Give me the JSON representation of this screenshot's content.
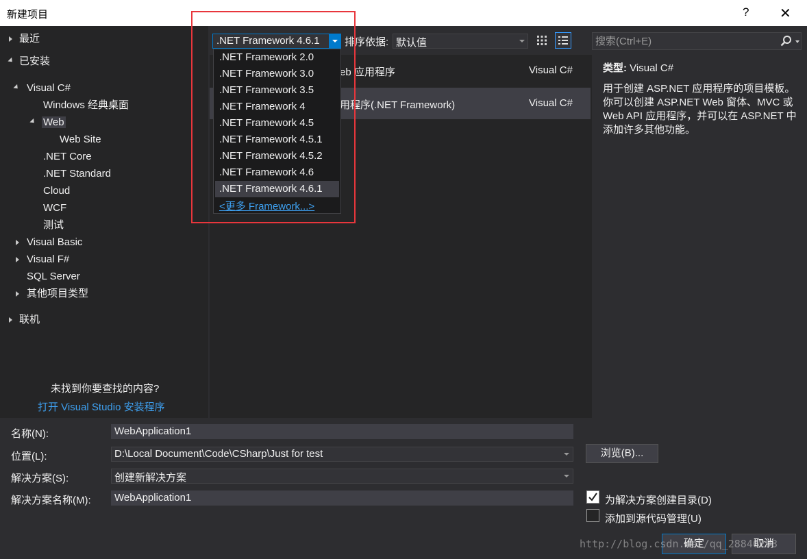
{
  "window": {
    "title": "新建项目",
    "help": "?",
    "close": "✕"
  },
  "tree": {
    "recent": "最近",
    "installed": "已安装",
    "visual_csharp": "Visual C#",
    "windows_desktop": "Windows 经典桌面",
    "web": "Web",
    "web_site": "Web Site",
    "net_core": ".NET Core",
    "net_standard": ".NET Standard",
    "cloud": "Cloud",
    "wcf": "WCF",
    "test": "测试",
    "visual_basic": "Visual Basic",
    "visual_fsharp": "Visual F#",
    "sql_server": "SQL Server",
    "other_types": "其他项目类型",
    "online": "联机",
    "not_found": "未找到你要查找的内容?",
    "open_installer": "打开 Visual Studio 安装程序"
  },
  "toolbar": {
    "framework_selected": ".NET Framework 4.6.1",
    "sort_label": "排序依据:",
    "sort_value": "默认值",
    "search_placeholder": "搜索(Ctrl+E)"
  },
  "framework_options": [
    ".NET Framework 2.0",
    ".NET Framework 3.0",
    ".NET Framework 3.5",
    ".NET Framework 4",
    ".NET Framework 4.5",
    ".NET Framework 4.5.1",
    ".NET Framework 4.5.2",
    ".NET Framework 4.6",
    ".NET Framework 4.6.1"
  ],
  "framework_more": "<更多 Framework...>",
  "templates": [
    {
      "name": "eb 应用程序",
      "lang": "Visual C#"
    },
    {
      "name": "用程序(.NET Framework)",
      "lang": "Visual C#"
    }
  ],
  "description": {
    "type_label": "类型:",
    "type_value": "Visual C#",
    "text": "用于创建 ASP.NET 应用程序的项目模板。你可以创建 ASP.NET Web 窗体、MVC 或 Web API 应用程序，并可以在 ASP.NET 中添加许多其他功能。"
  },
  "form": {
    "name_label": "名称(N):",
    "name_value": "WebApplication1",
    "location_label": "位置(L):",
    "location_value": "D:\\Local Document\\Code\\CSharp\\Just for test",
    "solution_label": "解决方案(S):",
    "solution_value": "创建新解决方案",
    "solution_name_label": "解决方案名称(M):",
    "solution_name_value": "WebApplication1",
    "browse": "浏览(B)...",
    "create_dir_label": "为解决方案创建目录(D)",
    "create_dir_checked": true,
    "source_control_label": "添加到源代码管理(U)",
    "source_control_checked": false,
    "ok": "确定",
    "cancel": "取消"
  },
  "watermark": "http://blog.csdn.net/qq_28840293",
  "colors": {
    "accent": "#007acc",
    "highlight_box": "#e8363c",
    "link": "#3ea0f0"
  }
}
